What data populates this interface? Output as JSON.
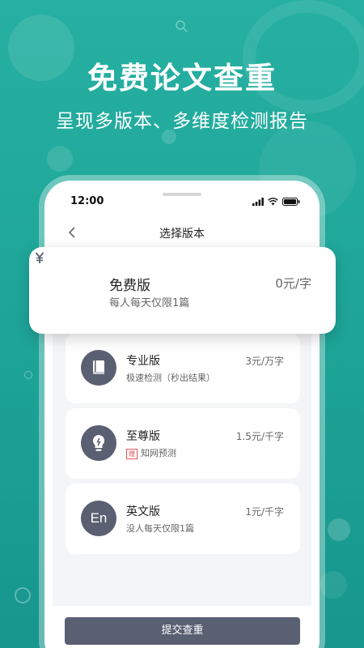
{
  "hero": {
    "title": "免费论文查重",
    "subtitle": "呈现多版本、多维度检测报告"
  },
  "status_bar": {
    "time": "12:00"
  },
  "nav": {
    "title": "选择版本"
  },
  "plans": [
    {
      "name": "免费版",
      "desc": "每人每天仅限1篇",
      "price": "0元/字",
      "icon": "yuan-icon"
    },
    {
      "name": "专业版",
      "desc": "极速检测（秒出结果）",
      "price": "3元/万字",
      "icon": "book-icon"
    },
    {
      "name": "至尊版",
      "badge": "赠",
      "desc": "知网预测",
      "price": "1.5元/千字",
      "icon": "lightbulb-icon"
    },
    {
      "name": "英文版",
      "desc": "没人每天仅限1篇",
      "price": "1元/千字",
      "icon": "en-icon",
      "icon_text": "En"
    }
  ],
  "submit": {
    "label": "提交查重"
  },
  "colors": {
    "background": "#1fa699",
    "icon_circle": "#5a5f72",
    "button": "#5a5f72",
    "badge": "#e05a5a"
  }
}
